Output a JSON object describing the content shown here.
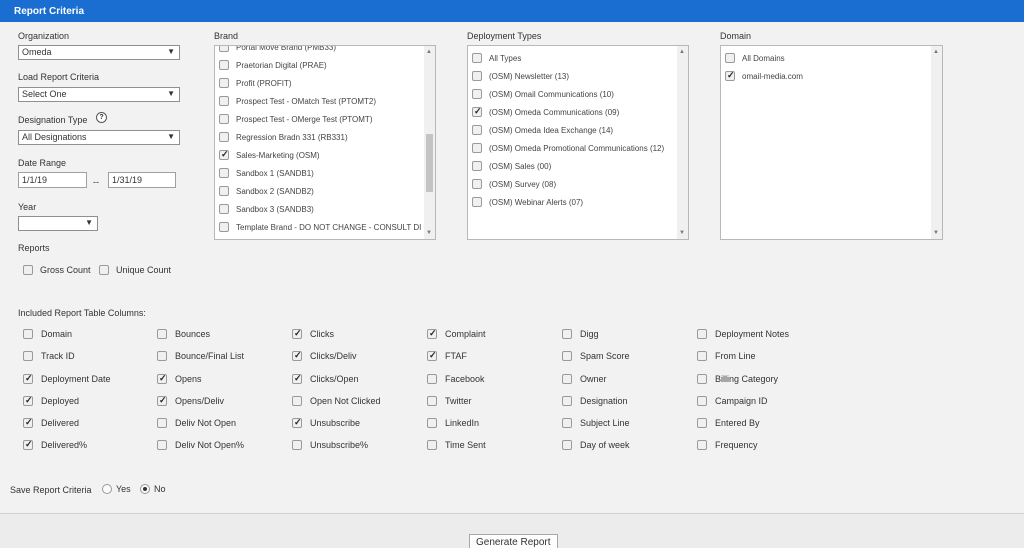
{
  "header": {
    "title": "Report Criteria"
  },
  "organization": {
    "label": "Organization",
    "value": "Omeda"
  },
  "load_criteria": {
    "label": "Load Report Criteria",
    "value": "Select One"
  },
  "designation_type": {
    "label": "Designation Type",
    "help": "?",
    "value": "All Designations"
  },
  "date_range": {
    "label": "Date Range",
    "start": "1/1/19",
    "separator": "--",
    "end": "1/31/19"
  },
  "year": {
    "label": "Year",
    "value": ""
  },
  "reports": {
    "label": "Reports",
    "options": [
      {
        "label": "Gross Count",
        "checked": false
      },
      {
        "label": "Unique Count",
        "checked": false
      }
    ]
  },
  "brand": {
    "label": "Brand",
    "items": [
      {
        "label": "Portal Move Brand (PMB33)",
        "checked": false
      },
      {
        "label": "Praetorian Digital (PRAE)",
        "checked": false
      },
      {
        "label": "Profit (PROFIT)",
        "checked": false
      },
      {
        "label": "Prospect Test - OMatch Test (PTOMT2)",
        "checked": false
      },
      {
        "label": "Prospect Test - OMerge Test (PTOMT)",
        "checked": false
      },
      {
        "label": "Regression Bradn 331 (RB331)",
        "checked": false
      },
      {
        "label": "Sales-Marketing (OSM)",
        "checked": true
      },
      {
        "label": "Sandbox 1 (SANDB1)",
        "checked": false
      },
      {
        "label": "Sandbox 2 (SANDB2)",
        "checked": false
      },
      {
        "label": "Sandbox 3 (SANDB3)",
        "checked": false
      },
      {
        "label": "Template Brand - DO NOT CHANGE - CONSULT DI",
        "checked": false
      }
    ]
  },
  "deployment_types": {
    "label": "Deployment Types",
    "items": [
      {
        "label": "All Types",
        "checked": false
      },
      {
        "label": "(OSM) Newsletter (13)",
        "checked": false
      },
      {
        "label": "(OSM) Omail Communications (10)",
        "checked": false
      },
      {
        "label": "(OSM) Omeda Communications (09)",
        "checked": true
      },
      {
        "label": "(OSM) Omeda Idea Exchange (14)",
        "checked": false
      },
      {
        "label": "(OSM) Omeda Promotional Communications (12)",
        "checked": false
      },
      {
        "label": "(OSM) Sales (00)",
        "checked": false
      },
      {
        "label": "(OSM) Survey (08)",
        "checked": false
      },
      {
        "label": "(OSM) Webinar Alerts (07)",
        "checked": false
      }
    ]
  },
  "domain": {
    "label": "Domain",
    "items": [
      {
        "label": "All Domains",
        "checked": false
      },
      {
        "label": "omail-media.com",
        "checked": true
      }
    ]
  },
  "columns": {
    "label": "Included Report Table Columns:",
    "groups": [
      [
        {
          "label": "Domain",
          "checked": false
        },
        {
          "label": "Track ID",
          "checked": false
        },
        {
          "label": "Deployment Date",
          "checked": true
        },
        {
          "label": "Deployed",
          "checked": true
        },
        {
          "label": "Delivered",
          "checked": true
        },
        {
          "label": "Delivered%",
          "checked": true
        }
      ],
      [
        {
          "label": "Bounces",
          "checked": false
        },
        {
          "label": "Bounce/Final List",
          "checked": false
        },
        {
          "label": "Opens",
          "checked": true
        },
        {
          "label": "Opens/Deliv",
          "checked": true
        },
        {
          "label": "Deliv Not Open",
          "checked": false
        },
        {
          "label": "Deliv Not Open%",
          "checked": false
        }
      ],
      [
        {
          "label": "Clicks",
          "checked": true
        },
        {
          "label": "Clicks/Deliv",
          "checked": true
        },
        {
          "label": "Clicks/Open",
          "checked": true
        },
        {
          "label": "Open Not Clicked",
          "checked": false
        },
        {
          "label": "Unsubscribe",
          "checked": true
        },
        {
          "label": "Unsubscribe%",
          "checked": false
        }
      ],
      [
        {
          "label": "Complaint",
          "checked": true
        },
        {
          "label": "FTAF",
          "checked": true
        },
        {
          "label": "Facebook",
          "checked": false
        },
        {
          "label": "Twitter",
          "checked": false
        },
        {
          "label": "LinkedIn",
          "checked": false
        },
        {
          "label": "Time Sent",
          "checked": false
        }
      ],
      [
        {
          "label": "Digg",
          "checked": false
        },
        {
          "label": "Spam Score",
          "checked": false
        },
        {
          "label": "Owner",
          "checked": false
        },
        {
          "label": "Designation",
          "checked": false
        },
        {
          "label": "Subject Line",
          "checked": false
        },
        {
          "label": "Day of week",
          "checked": false
        }
      ],
      [
        {
          "label": "Deployment Notes",
          "checked": false
        },
        {
          "label": "From Line",
          "checked": false
        },
        {
          "label": "Billing Category",
          "checked": false
        },
        {
          "label": "Campaign ID",
          "checked": false
        },
        {
          "label": "Entered By",
          "checked": false
        },
        {
          "label": "Frequency",
          "checked": false
        }
      ]
    ]
  },
  "save_criteria": {
    "label": "Save Report Criteria",
    "yes": "Yes",
    "no": "No",
    "selected": "No"
  },
  "generate_button": "Generate Report"
}
